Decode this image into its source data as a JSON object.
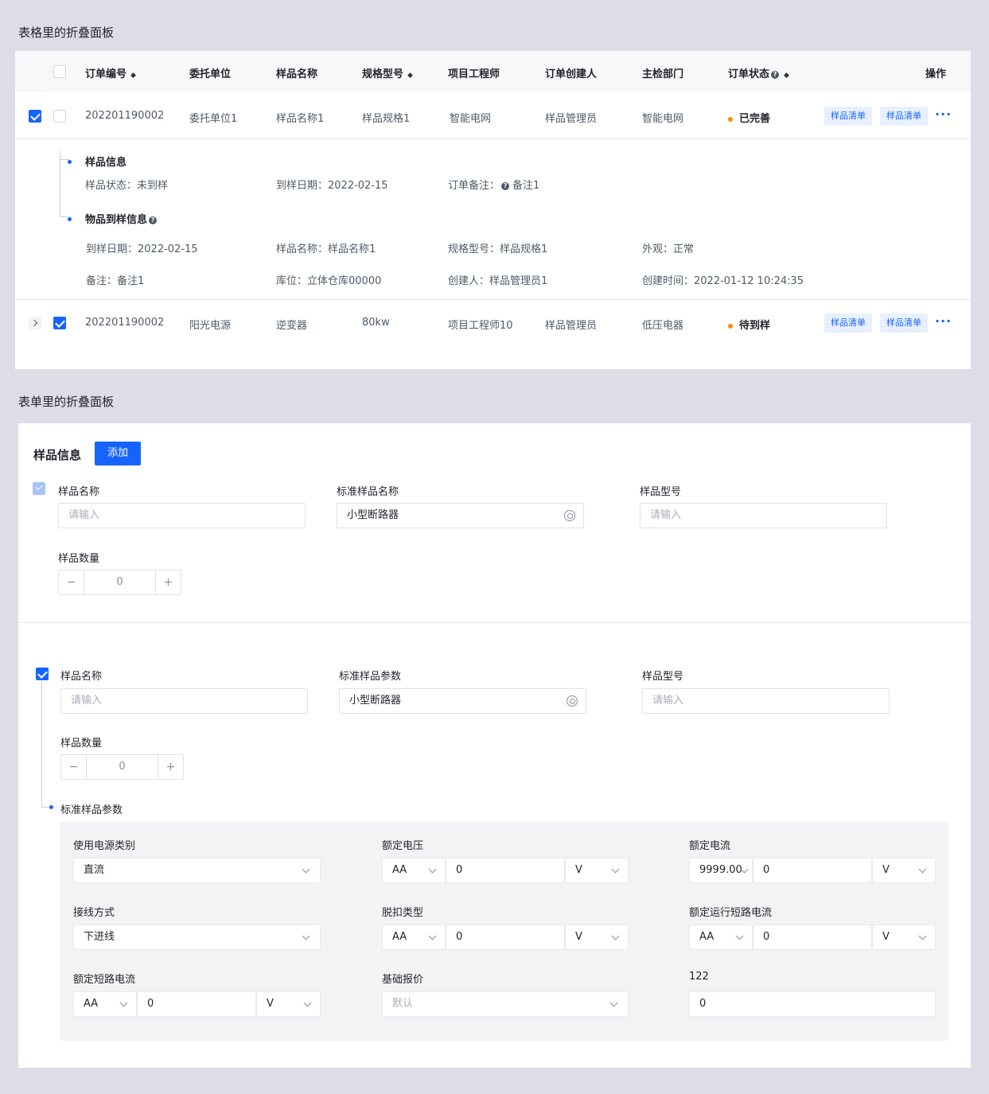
{
  "section1": {
    "title": "表格里的折叠面板"
  },
  "table": {
    "headers": {
      "order_no": "订单编号",
      "client": "委托单位",
      "sample_name": "样品名称",
      "spec": "规格型号",
      "engineer": "项目工程师",
      "creator": "订单创建人",
      "dept": "主检部门",
      "status": "订单状态",
      "action": "操作"
    },
    "rows": [
      {
        "order_no": "202201190002",
        "client": "委托单位1",
        "sample_name": "样品名称1",
        "spec": "样品规格1",
        "engineer": "智能电网",
        "creator": "样品管理员",
        "dept": "智能电网",
        "status": "已完善",
        "tag1": "样品清单",
        "tag2": "样品清单",
        "more": "···"
      },
      {
        "order_no": "202201190002",
        "client": "阳光电源",
        "sample_name": "逆变器",
        "spec": "80kw",
        "engineer": "项目工程师10",
        "creator": "样品管理员",
        "dept": "低压电器",
        "status": "待到样",
        "tag1": "样品清单",
        "tag2": "样品清单",
        "more": "···"
      }
    ],
    "expanded": {
      "sample_info_title": "样品信息",
      "sample_status": "样品状态：未到样",
      "arrival_date": "到样日期：2022-02-15",
      "order_note_label": "订单备注：",
      "order_note_value": "备注1",
      "arrival_info_title": "物品到样信息",
      "a_date": "到样日期：2022-02-15",
      "a_name": "样品名称：样品名称1",
      "a_spec": "规格型号：样品规格1",
      "a_look": "外观：正常",
      "a_note": "备注：备注1",
      "a_loc": "库位：立体仓库00000",
      "a_creator": "创建人：样品管理员1",
      "a_time": "创建时间：2022-01-12 10:24:35"
    }
  },
  "section2": {
    "title": "表单里的折叠面板"
  },
  "form": {
    "header_title": "样品信息",
    "add_button": "添加",
    "group1": {
      "name_label": "样品名称",
      "name_placeholder": "请输入",
      "std_label": "标准样品名称",
      "std_value": "小型断路器",
      "model_label": "样品型号",
      "model_placeholder": "请输入",
      "qty_label": "样品数量",
      "qty_value": "0",
      "minus": "−",
      "plus": "+"
    },
    "group2": {
      "name_label": "样品名称",
      "name_placeholder": "请输入",
      "std_label": "标准样品参数",
      "std_value": "小型断路器",
      "model_label": "样品型号",
      "model_placeholder": "请输入",
      "qty_label": "样品数量",
      "qty_value": "0",
      "minus": "−",
      "plus": "+",
      "params_title": "标准样品参数"
    },
    "params": {
      "power_type_label": "使用电源类别",
      "power_type_value": "直流",
      "rated_voltage_label": "额定电压",
      "rated_voltage_unit1": "AA",
      "rated_voltage_value": "0",
      "rated_voltage_unit2": "V",
      "rated_current_label": "额定电流",
      "rated_current_unit1": "9999.00",
      "rated_current_value": "0",
      "rated_current_unit2": "V",
      "wiring_label": "接线方式",
      "wiring_value": "下进线",
      "trip_label": "脱扣类型",
      "trip_unit1": "AA",
      "trip_value": "0",
      "trip_unit2": "V",
      "run_short_label": "额定运行短路电流",
      "run_short_unit1": "AA",
      "run_short_value": "0",
      "run_short_unit2": "V",
      "short_label": "额定短路电流",
      "short_unit1": "AA",
      "short_value": "0",
      "short_unit2": "V",
      "base_price_label": "基础报价",
      "base_price_placeholder": "默认",
      "field122_label": "122",
      "field122_value": "0"
    }
  }
}
